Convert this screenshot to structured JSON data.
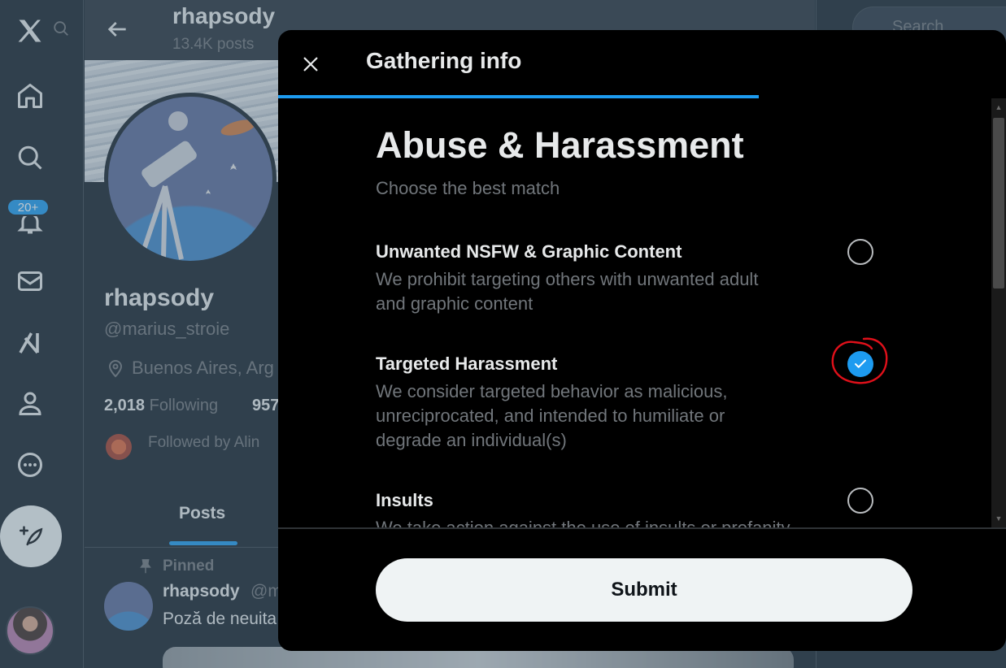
{
  "nav": {
    "notifications_badge": "20+"
  },
  "profile": {
    "top_name": "rhapsody",
    "top_posts": "13.4K posts",
    "name": "rhapsody",
    "handle": "@marius_stroie",
    "location": "Buenos Aires, Arg",
    "following_count": "2,018",
    "following_label": "Following",
    "followers_count_partial": "957",
    "followed_by": "Followed by Alin",
    "tab_posts": "Posts",
    "pinned_label": "Pinned",
    "post_name": "rhapsody",
    "post_handle": "@m",
    "post_text": "Poză de neuita"
  },
  "right": {
    "search_placeholder": "Search"
  },
  "modal": {
    "title": "Gathering info",
    "heading": "Abuse & Harassment",
    "subheading": "Choose the best match",
    "progress_percent": 66,
    "options": [
      {
        "title": "Unwanted NSFW & Graphic Content",
        "desc_line1": "We prohibit targeting others with unwanted adult",
        "desc_line2": "and graphic content",
        "selected": false
      },
      {
        "title": "Targeted Harassment",
        "desc_line1": "We consider targeted behavior as malicious,",
        "desc_line2": "unreciprocated, and intended to humiliate or",
        "desc_line3": "degrade an individual(s)",
        "selected": true
      },
      {
        "title": "Insults",
        "desc_line1": "We take action against the use of insults or profanity",
        "selected": false
      }
    ],
    "submit_label": "Submit"
  },
  "colors": {
    "accent": "#1d9bf0",
    "annotation_red": "#e0101a"
  }
}
